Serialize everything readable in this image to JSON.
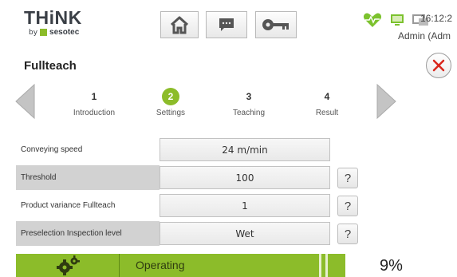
{
  "header": {
    "logo_text": "THiNK",
    "logo_by": "by",
    "logo_brand": "sesotec",
    "time": "16:12:2",
    "user": "Admin (Adm",
    "icons": [
      "home-icon",
      "message-icon",
      "key-icon",
      "heart-monitor-icon",
      "monitor-icon",
      "network-icon"
    ]
  },
  "title": "Fullteach",
  "steps": [
    {
      "num": "1",
      "label": "Introduction"
    },
    {
      "num": "2",
      "label": "Settings"
    },
    {
      "num": "3",
      "label": "Teaching"
    },
    {
      "num": "4",
      "label": "Result"
    }
  ],
  "rows": [
    {
      "label": "Conveying speed",
      "value": "24 m/min"
    },
    {
      "label": "Threshold",
      "value": "100",
      "help": "?"
    },
    {
      "label": "Product variance Fullteach",
      "value": "1",
      "help": "?"
    },
    {
      "label": "Preselection Inspection level",
      "value": "Wet",
      "help": "?"
    }
  ],
  "bottom": {
    "status": "Operating",
    "percent": "9%"
  },
  "colors": {
    "accent": "#8cbc2a",
    "close": "#d9261c",
    "heart": "#7cc22e"
  }
}
